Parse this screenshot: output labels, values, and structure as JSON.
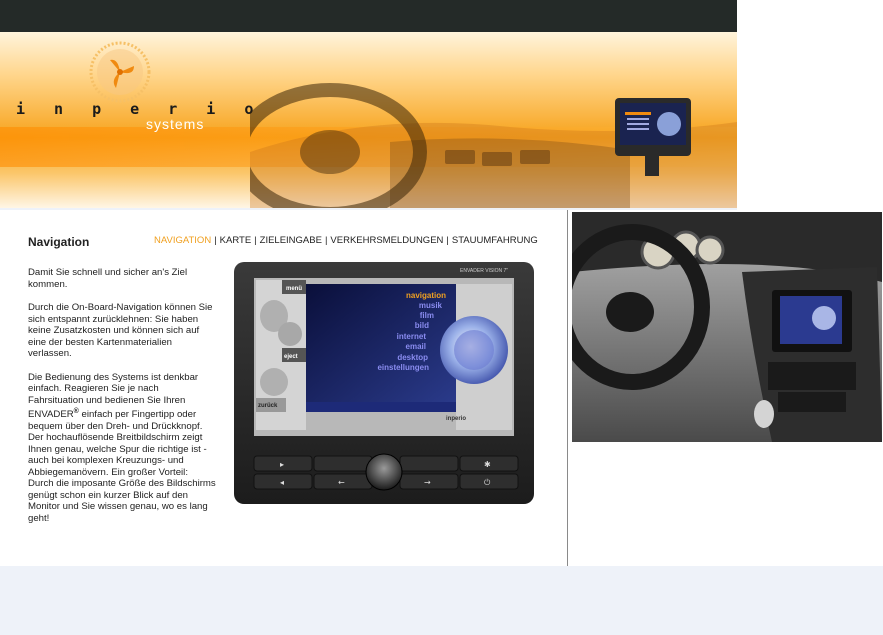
{
  "brand": {
    "wordmark": "i n p e r i o",
    "sub": "systems"
  },
  "colors": {
    "accent": "#f0a020",
    "header_orange": "#f7a31c",
    "topbar": "#242a28"
  },
  "page": {
    "title": "Navigation"
  },
  "nav": {
    "items": [
      {
        "label": "NAVIGATION",
        "active": true
      },
      {
        "label": "KARTE"
      },
      {
        "label": "ZIELEINGABE"
      },
      {
        "label": "VERKEHRSMELDUNGEN"
      },
      {
        "label": "STAUUMFAHRUNG"
      }
    ],
    "separator": "|"
  },
  "body": {
    "p1": "Damit Sie schnell und sicher an's Ziel kommen.",
    "p2": "Durch die On-Board-Navigation können Sie sich entspannt zurücklehnen: Sie haben keine Zusatzkosten und können sich auf eine der besten Kartenmaterialien verlassen.",
    "p3_a": "Die Bedienung des Systems ist denkbar einfach. Reagieren Sie je nach Fahrsituation und bedienen Sie Ihren ENVADER",
    "p3_reg": "®",
    "p3_b": " einfach per Fingertipp oder bequem über den Dreh- und Drückknopf. Der hochauflösende Breitbildschirm zeigt Ihnen genau, welche Spur die richtige ist - auch bei komplexen Kreuzungs- und Abbiegemanövern. Ein großer Vorteil: Durch die imposante Größe des Bildschirms genügt schon ein kurzer Blick auf den Monitor und Sie wissen genau, wo es lang geht!"
  },
  "device": {
    "model": "ENVADER VISION 7\"",
    "side_buttons": [
      "menü",
      "eject",
      "zurück"
    ],
    "menu": [
      "navigation",
      "musik",
      "film",
      "bild",
      "internet",
      "email",
      "desktop",
      "einstellungen"
    ],
    "bezel_brand": "inperio"
  }
}
